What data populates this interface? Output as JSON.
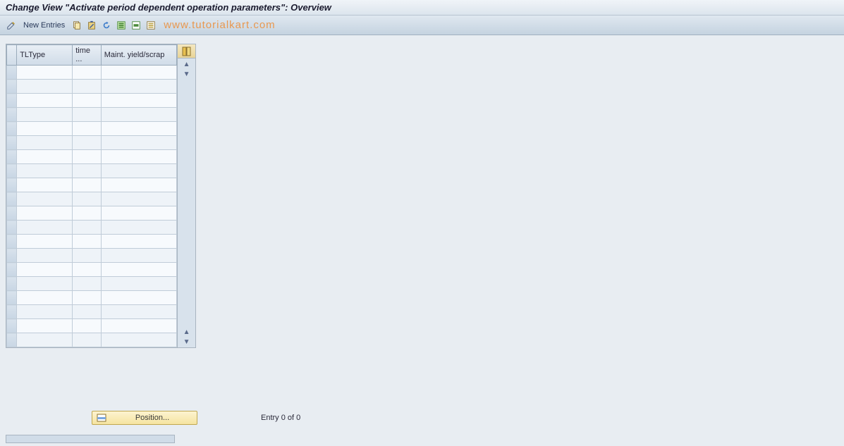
{
  "title": "Change View \"Activate period dependent operation parameters\": Overview",
  "toolbar": {
    "new_entries_label": "New Entries"
  },
  "watermark": "www.tutorialkart.com",
  "table": {
    "headers": {
      "col1": "TLType",
      "col2": "time ...",
      "col3": "Maint. yield/scrap"
    },
    "rows": [
      {
        "tltype": "",
        "time": "",
        "maint": ""
      },
      {
        "tltype": "",
        "time": "",
        "maint": ""
      },
      {
        "tltype": "",
        "time": "",
        "maint": ""
      },
      {
        "tltype": "",
        "time": "",
        "maint": ""
      },
      {
        "tltype": "",
        "time": "",
        "maint": ""
      },
      {
        "tltype": "",
        "time": "",
        "maint": ""
      },
      {
        "tltype": "",
        "time": "",
        "maint": ""
      },
      {
        "tltype": "",
        "time": "",
        "maint": ""
      },
      {
        "tltype": "",
        "time": "",
        "maint": ""
      },
      {
        "tltype": "",
        "time": "",
        "maint": ""
      },
      {
        "tltype": "",
        "time": "",
        "maint": ""
      },
      {
        "tltype": "",
        "time": "",
        "maint": ""
      },
      {
        "tltype": "",
        "time": "",
        "maint": ""
      },
      {
        "tltype": "",
        "time": "",
        "maint": ""
      },
      {
        "tltype": "",
        "time": "",
        "maint": ""
      },
      {
        "tltype": "",
        "time": "",
        "maint": ""
      },
      {
        "tltype": "",
        "time": "",
        "maint": ""
      },
      {
        "tltype": "",
        "time": "",
        "maint": ""
      },
      {
        "tltype": "",
        "time": "",
        "maint": ""
      },
      {
        "tltype": "",
        "time": "",
        "maint": ""
      }
    ]
  },
  "footer": {
    "position_label": "Position...",
    "entry_text": "Entry 0 of 0"
  }
}
